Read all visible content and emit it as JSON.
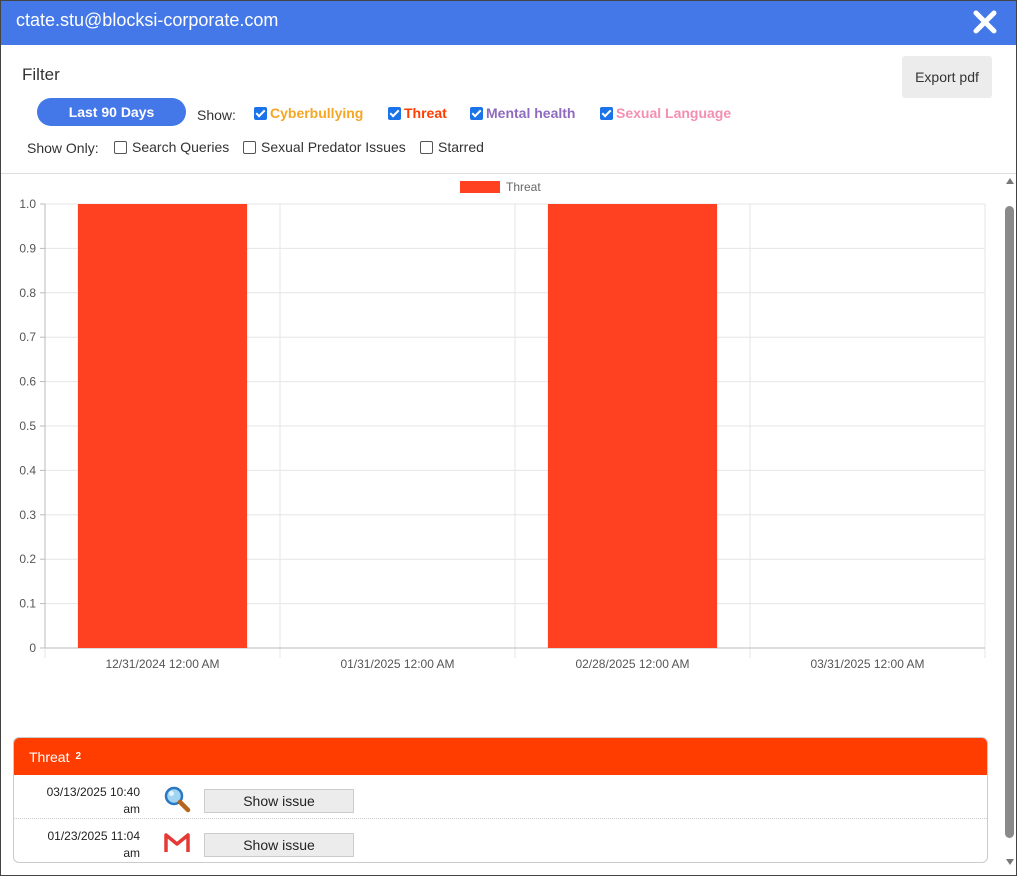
{
  "window": {
    "title": "ctate.stu@blocksi-corporate.com"
  },
  "filter": {
    "title": "Filter",
    "export_label": "Export pdf",
    "range_label": "Last 90 Days",
    "show_label": "Show:",
    "categories": [
      {
        "label": "Cyberbullying",
        "color": "#f5a623",
        "checked": true
      },
      {
        "label": "Threat",
        "color": "#ff3d00",
        "checked": true
      },
      {
        "label": "Mental health",
        "color": "#8e6bbf",
        "checked": true
      },
      {
        "label": "Sexual Language",
        "color": "#f48fb1",
        "checked": true
      }
    ],
    "show_only_label": "Show Only:",
    "show_only": [
      {
        "label": "Search Queries",
        "checked": false
      },
      {
        "label": "Sexual Predator Issues",
        "checked": false
      },
      {
        "label": "Starred",
        "checked": false
      }
    ]
  },
  "chart_data": {
    "type": "bar",
    "categories": [
      "12/31/2024 12:00 AM",
      "01/31/2025 12:00 AM",
      "02/28/2025 12:00 AM",
      "03/31/2025 12:00 AM"
    ],
    "series": [
      {
        "name": "Threat",
        "values": [
          1,
          0,
          1,
          0
        ],
        "color": "#ff4122"
      }
    ],
    "ylim": [
      0,
      1
    ],
    "yticks": [
      "0",
      "0.1",
      "0.2",
      "0.3",
      "0.4",
      "0.5",
      "0.6",
      "0.7",
      "0.8",
      "0.9",
      "1.0"
    ],
    "grid": true,
    "legend": "top-center"
  },
  "issues": {
    "title": "Threat",
    "count": "2",
    "rows": [
      {
        "time_line1": "03/13/2025 10:40",
        "time_line2": "am",
        "icon": "search-icon",
        "button_label": "Show issue"
      },
      {
        "time_line1": "01/23/2025 11:04",
        "time_line2": "am",
        "icon": "gmail-icon",
        "button_label": "Show issue"
      }
    ]
  }
}
